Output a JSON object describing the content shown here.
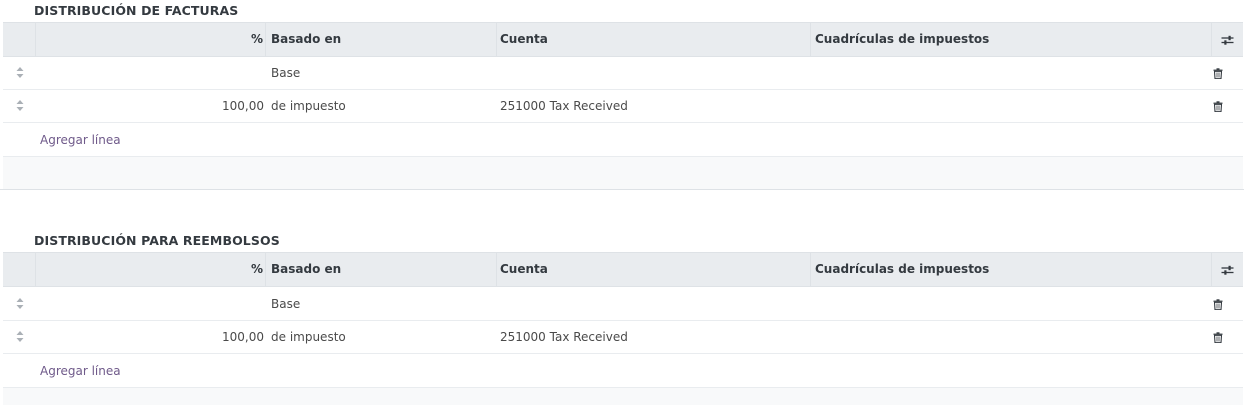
{
  "sections": [
    {
      "title": "DISTRIBUCIÓN DE FACTURAS",
      "headers": {
        "pct": "%",
        "based_on": "Basado en",
        "account": "Cuenta",
        "tax_grids": "Cuadrículas de impuestos"
      },
      "rows": [
        {
          "pct": "",
          "based_on": "Base",
          "account": ""
        },
        {
          "pct": "100,00",
          "based_on": "de impuesto",
          "account": "251000 Tax Received"
        }
      ],
      "add_line": "Agregar línea"
    },
    {
      "title": "DISTRIBUCIÓN PARA REEMBOLSOS",
      "headers": {
        "pct": "%",
        "based_on": "Basado en",
        "account": "Cuenta",
        "tax_grids": "Cuadrículas de impuestos"
      },
      "rows": [
        {
          "pct": "",
          "based_on": "Base",
          "account": ""
        },
        {
          "pct": "100,00",
          "based_on": "de impuesto",
          "account": "251000 Tax Received"
        }
      ],
      "add_line": "Agregar línea"
    }
  ],
  "icons": {
    "drag_handle": "sort-handle-icon",
    "delete": "trash-icon",
    "optional_columns": "sliders-icon"
  },
  "colors": {
    "header_bg": "#e9ecef",
    "link": "#6f5a8a",
    "text": "#212529"
  }
}
